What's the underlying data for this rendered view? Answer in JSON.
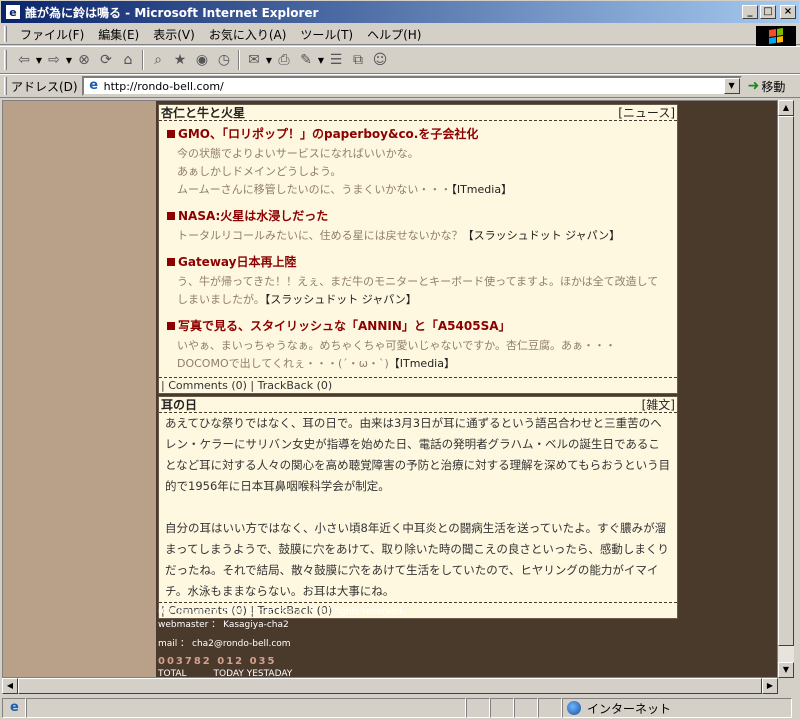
{
  "window": {
    "title": "誰が為に鈴は鳴る - Microsoft Internet Explorer",
    "buttons": {
      "minimize": "_",
      "maximize": "□",
      "close": "×"
    }
  },
  "menu": [
    "ファイル(F)",
    "編集(E)",
    "表示(V)",
    "お気に入り(A)",
    "ツール(T)",
    "ヘルプ(H)"
  ],
  "toolbar": {
    "icons": [
      "back-icon",
      "forward-icon",
      "stop-icon",
      "refresh-icon",
      "home-icon",
      "search-icon",
      "favorites-icon",
      "history-icon",
      "mail-icon",
      "print-icon",
      "edit-icon",
      "discuss-icon",
      "messenger-icon"
    ]
  },
  "address": {
    "label": "アドレス(D)",
    "url": "http://rondo-bell.com/",
    "go": "移動"
  },
  "entries": [
    {
      "title": "杏仁と牛と火星",
      "category": "[ニュース]",
      "news": [
        {
          "headline": "GMO、「ロリポップ！」のpaperboy&co.を子会社化",
          "lines": [
            "今の状態でよりよいサービスになればいいかな。",
            "あぁしかしドメインどうしよう。",
            "ムームーさんに移管したいのに、うまくいかない・・・"
          ],
          "source": "【ITmedia】"
        },
        {
          "headline": "NASA:火星は水浸しだった",
          "lines": [
            "トータルリコールみたいに、住める星には戻せないかな？"
          ],
          "source": "【スラッシュドット ジャパン】"
        },
        {
          "headline": "Gateway日本再上陸",
          "lines": [
            "う、牛が帰ってきた！！えぇ、まだ牛のモニターとキーボード使ってますよ。ほかは全て改造してしまいましたが。"
          ],
          "source": "【スラッシュドット ジャパン】"
        },
        {
          "headline": "写真で見る、スタイリッシュな「ANNIN」と「A5405SA」",
          "lines": [
            "いやぁ、まいっちゃうなぁ。めちゃくちゃ可愛いじゃないですか。杏仁豆腐。あぁ・・・DOCOMOで出してくれぇ・・・(´・ω・`)"
          ],
          "source": "【ITmedia】"
        }
      ],
      "footer": "| Comments (0) | TrackBack (0)"
    },
    {
      "title": "耳の日",
      "category": "[雑文]",
      "paragraphs": [
        "あえてひな祭りではなく、耳の日で。由来は3月3日が耳に通ずるという語呂合わせと三重苦のヘレン・ケラーにサリバン女史が指導を始めた日、電話の発明者グラハム・ベルの誕生日であることなど耳に対する人々の関心を高め聴覚障害の予防と治療に対する理解を深めてもらおうという目的で1956年に日本耳鼻咽喉科学会が制定。",
        "自分の耳はいい方ではなく、小さい頃8年近く中耳炎との闘病生活を送っていたよ。すぐ膿みが溜まってしまうようで、鼓膜に穴をあけて、取り除いた時の聞こえの良さといったら、感動しまくりだったね。それで結局、散々鼓膜に穴をあけて生活をしていたので、ヒヤリングの能力がイマイチ。水泳もままならない。お耳は大事にね。"
      ],
      "footer": "| Comments (0) | TrackBack (0)"
    }
  ],
  "site_footer": {
    "copyright": "(C) Copyright 2004 Rondo-Bell.com All rights reserved.",
    "webmaster": "webmaster ： Kasagiya-cha2",
    "mail": "mail ： cha2@rondo-bell.com",
    "counter": "003782 012  035",
    "counter_labels": "TOTAL　　　TODAY YESTADAY"
  },
  "status": {
    "zone": "インターネット"
  }
}
